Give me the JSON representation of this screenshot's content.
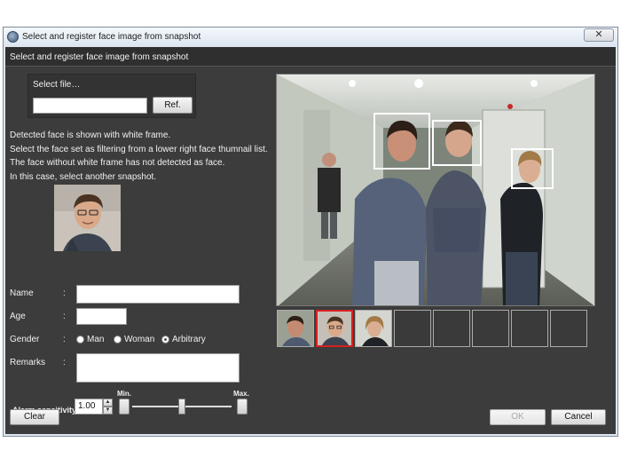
{
  "window": {
    "title": "Select and register face image from snapshot",
    "close_label": "✕"
  },
  "header": {
    "title": "Select and register face image from snapshot"
  },
  "file": {
    "label": "Select file…",
    "value": "",
    "ref_label": "Ref."
  },
  "instructions": [
    "Detected face is shown with white frame.",
    "Select the face set as filtering from a lower right face thumnail list.",
    "The face without white frame has not detected as face.",
    "In this case, select another snapshot."
  ],
  "form": {
    "name_label": "Name",
    "name_value": "",
    "age_label": "Age",
    "age_value": "",
    "gender_label": "Gender",
    "gender_options": [
      "Man",
      "Woman",
      "Arbitrary"
    ],
    "gender_selected": "Arbitrary",
    "remarks_label": "Remarks",
    "remarks_value": "",
    "colon": ":"
  },
  "alarm": {
    "label": "Alarm sensitivity",
    "value": "1.00",
    "min_label": "Min.",
    "max_label": "Max.",
    "slider_fraction": 0.5
  },
  "thumbnails": {
    "count": 8,
    "filled": 3,
    "selected_index": 1
  },
  "footer": {
    "clear_label": "Clear",
    "ok_label": "OK",
    "cancel_label": "Cancel"
  },
  "colors": {
    "background": "#3c3c3c",
    "selection": "#d62020",
    "detect_frame": "#ffffff"
  }
}
